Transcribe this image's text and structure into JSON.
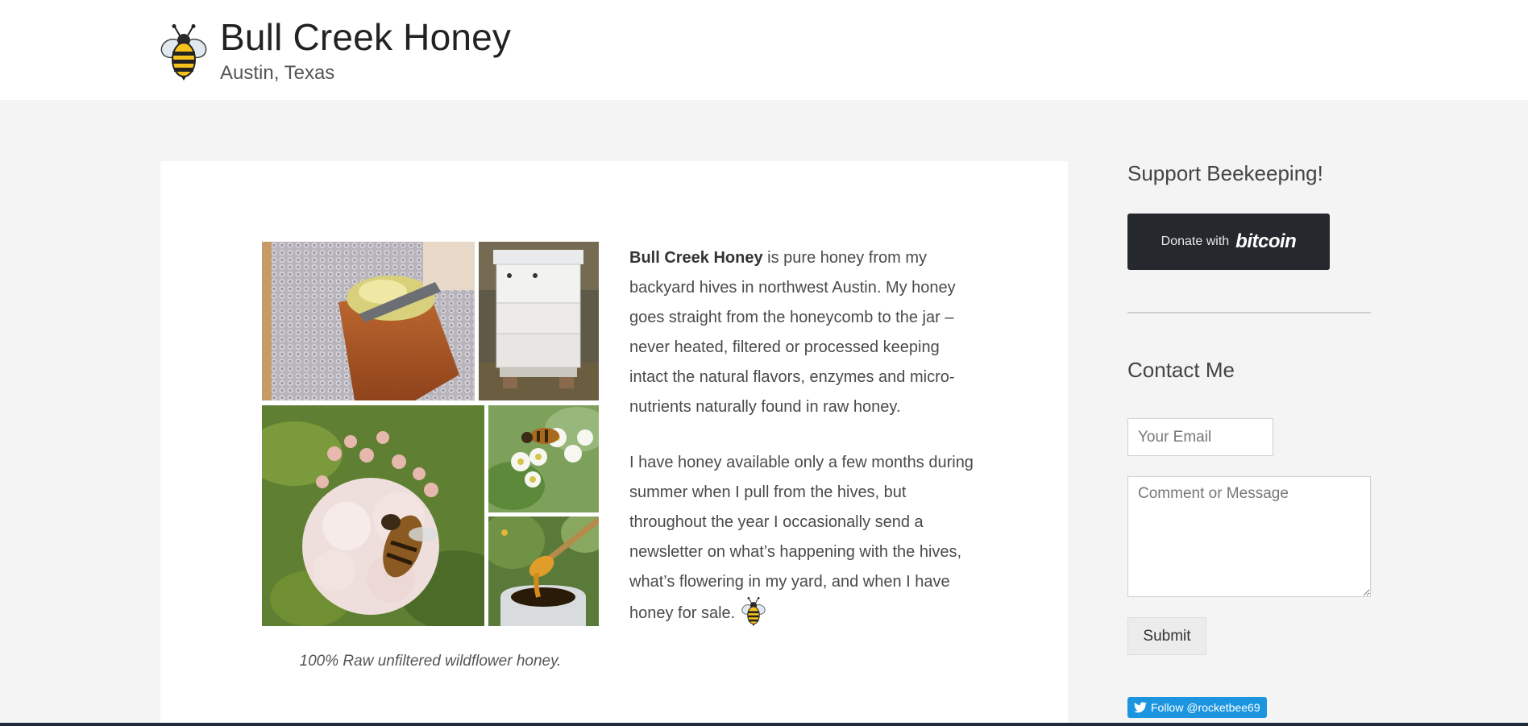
{
  "site": {
    "title": "Bull Creek Honey",
    "tagline": "Austin, Texas",
    "logo_icon": "bee-icon"
  },
  "main": {
    "gallery": {
      "photos": [
        "honeycomb-frame-photo",
        "beehive-box-photo",
        "bee-on-flower-photo",
        "bee-on-white-blossom-photo",
        "honey-dipper-jar-photo"
      ],
      "caption": "100% Raw unfiltered wildflower honey."
    },
    "intro": {
      "brand_bold": "Bull Creek Honey",
      "paragraph_1_rest": " is pure honey from my backyard hives in northwest Austin. My honey goes straight from the honeycomb to the jar – never heated, filtered or processed keeping intact the natural flavors, enzymes and micro-nutrients naturally found in raw honey.",
      "paragraph_2": "I have honey available only a few months during summer when I pull from the hives, but throughout the year I occasionally send a newsletter on what’s happening with the hives, what’s flowering in my yard, and when I have honey for sale."
    }
  },
  "sidebar": {
    "support": {
      "title": "Support Beekeeping!",
      "donate_prefix": "Donate with",
      "donate_brand": "bitcoin"
    },
    "contact": {
      "title": "Contact Me",
      "email_placeholder": "Your Email",
      "message_placeholder": "Comment or Message",
      "submit_label": "Submit"
    },
    "twitter": {
      "follow_label": "Follow @rocketbee69",
      "icon": "twitter-bird-icon"
    }
  },
  "colors": {
    "page_background": "#f4f4f4",
    "donate_button": "#25282c",
    "twitter_blue": "#1b95e0"
  }
}
